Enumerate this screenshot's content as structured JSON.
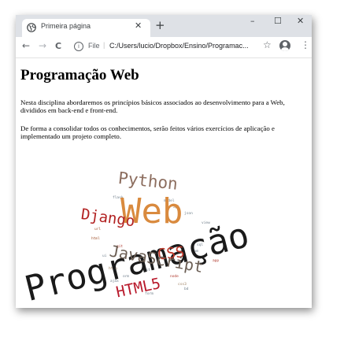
{
  "browser": {
    "tab": {
      "title": "Primeira página",
      "close_glyph": "✕",
      "favicon": "globe-icon"
    },
    "new_tab_glyph": "+",
    "window_controls": {
      "minimize": "–",
      "maximize": "☐",
      "close": "✕"
    },
    "toolbar": {
      "back_glyph": "←",
      "forward_glyph": "→",
      "reload_glyph": "C",
      "info_glyph": "i",
      "url_scheme": "File",
      "url_separator": "|",
      "url": "C:/Users/lucio/Dropbox/Ensino/Programac...",
      "star_glyph": "☆",
      "menu_glyph": "⋮"
    }
  },
  "page": {
    "title": "Programação Web",
    "paragraphs": [
      "Nesta disciplina abordaremos os princípios básicos associados ao desenvolvimento para a Web, divididos em back-end e front-end.",
      "De forma a consolidar todos os conhecimentos, serão feitos vários exercícios de aplicação e implementado um projeto completo."
    ],
    "word_cloud": {
      "words": [
        {
          "text": "Python",
          "color": "#8c6d5e"
        },
        {
          "text": "Web",
          "color": "#d98a3e"
        },
        {
          "text": "Django",
          "color": "#b22222"
        },
        {
          "text": "Programação",
          "color": "#1a1a1a"
        },
        {
          "text": "CSS",
          "color": "#c0392b"
        },
        {
          "text": "JavaScript",
          "color": "#6b5e54"
        },
        {
          "text": "HTML5",
          "color": "#b8182a"
        }
      ],
      "small_words": [
        "flask",
        "api",
        "json",
        "html",
        "sql",
        "git",
        "dom",
        "http",
        "rest",
        "node",
        "orm",
        "css3",
        "ajax",
        "form",
        "url",
        "view",
        "model",
        "app",
        "ui",
        "bd"
      ]
    }
  }
}
